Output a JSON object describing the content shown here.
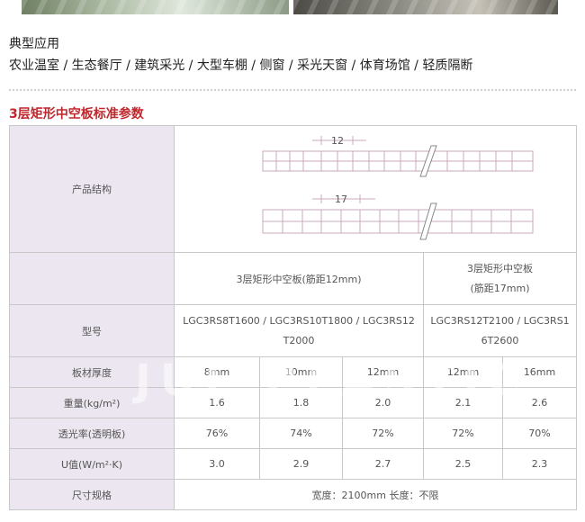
{
  "applications": {
    "title": "典型应用",
    "list": "农业温室 / 生态餐厅 / 建筑采光 / 大型车棚 / 侧窗 / 采光天窗 / 体育场馆 / 轻质隔断"
  },
  "table": {
    "title": "3层矩形中空板标准参数",
    "structure": {
      "label": "产品结构",
      "diagram_top_dim": "12",
      "diagram_bottom_dim": "17"
    },
    "variants": {
      "a_line1": "3层矩形中空板(筋距12mm)",
      "b_line1": "3层矩形中空板",
      "b_line2": "(筋距17mm)"
    },
    "model": {
      "label": "型号",
      "a_line1": "LGC3RS8T1600 / LGC3RS10T1800 / LGC3RS12",
      "a_line2": "T2000",
      "b_line1": "LGC3RS12T2100 / LGC3RS1",
      "b_line2": "6T2600"
    },
    "rows": [
      {
        "label": "板材厚度",
        "values": [
          "8mm",
          "10mm",
          "12mm",
          "12mm",
          "16mm"
        ]
      },
      {
        "label": "重量(kg/m²)",
        "values": [
          "1.6",
          "1.8",
          "2.0",
          "2.1",
          "2.6"
        ]
      },
      {
        "label": "透光率(透明板)",
        "values": [
          "76%",
          "74%",
          "72%",
          "72%",
          "70%"
        ]
      },
      {
        "label": "U值(W/m²·K)",
        "values": [
          "3.0",
          "2.9",
          "2.7",
          "2.5",
          "2.3"
        ]
      }
    ],
    "size": {
      "label": "尺寸规格",
      "value": "宽度：2100mm 长度：不限"
    }
  },
  "watermark": "JUL PLASTIC"
}
